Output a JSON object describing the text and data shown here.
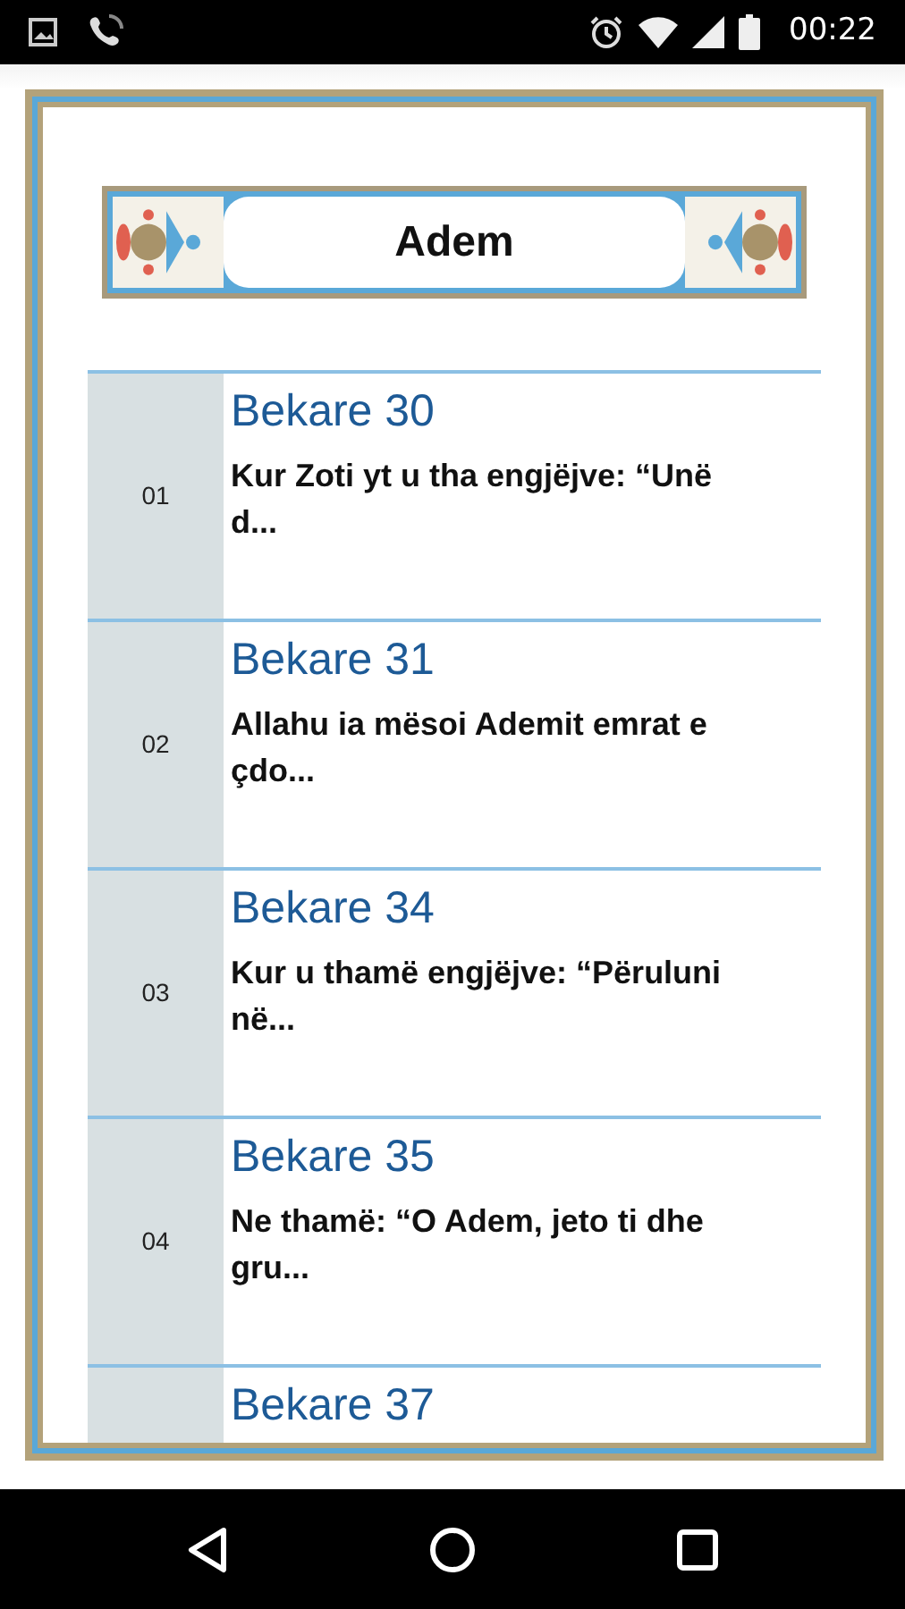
{
  "status_bar": {
    "time": "00:22"
  },
  "header": {
    "title": "Adem"
  },
  "items": [
    {
      "number": "01",
      "title": "Bekare 30",
      "excerpt": "Kur Zoti yt u tha engjëjve: “Unë d..."
    },
    {
      "number": "02",
      "title": "Bekare 31",
      "excerpt": "Allahu ia mësoi Ademit emrat e çdo..."
    },
    {
      "number": "03",
      "title": "Bekare 34",
      "excerpt": "Kur u thamë engjëjve: “Përuluni në..."
    },
    {
      "number": "04",
      "title": "Bekare 35",
      "excerpt": "Ne thamë: “O Adem, jeto ti dhe gru..."
    },
    {
      "title": "Bekare 37"
    }
  ]
}
